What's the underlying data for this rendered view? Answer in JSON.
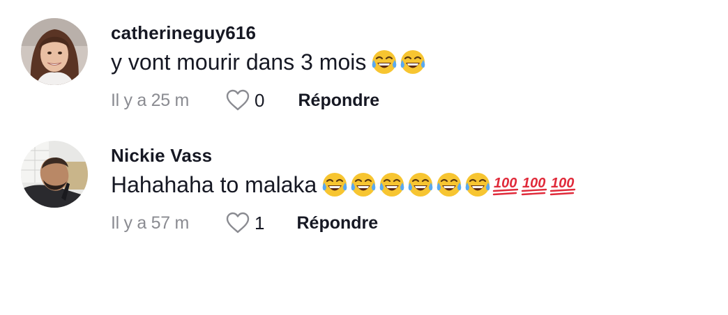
{
  "comments": [
    {
      "username": "catherineguy616",
      "text": "y vont mourir dans 3 mois",
      "emojis": [
        "face-with-tears-of-joy-icon",
        "face-with-tears-of-joy-icon"
      ],
      "timestamp": "Il y a 25 m",
      "likes": "0",
      "reply_label": "Répondre"
    },
    {
      "username": "Nickie Vass",
      "text": "Hahahaha to malaka",
      "emojis": [
        "face-with-tears-of-joy-icon",
        "face-with-tears-of-joy-icon",
        "face-with-tears-of-joy-icon",
        "face-with-tears-of-joy-icon",
        "face-with-tears-of-joy-icon",
        "face-with-tears-of-joy-icon",
        "hundred-points-icon",
        "hundred-points-icon",
        "hundred-points-icon"
      ],
      "timestamp": "Il y a 57 m",
      "likes": "1",
      "reply_label": "Répondre"
    }
  ],
  "colors": {
    "text_primary": "#161823",
    "text_secondary": "#8a8b91",
    "background": "#ffffff",
    "emoji_yellow": "#f7c531",
    "emoji_tear": "#5aa9f0",
    "hundred_red": "#e02a3a"
  }
}
